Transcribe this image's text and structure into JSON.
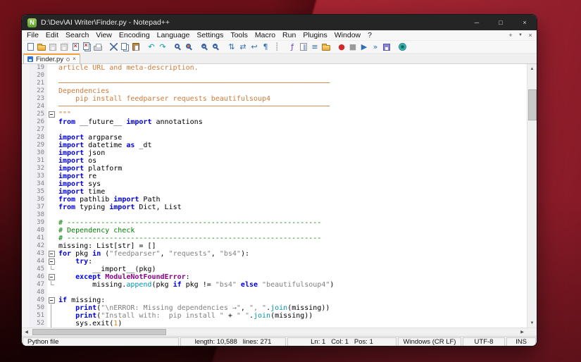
{
  "window": {
    "title": "D:\\Dev\\AI Writer\\Finder.py - Notepad++",
    "controls": {
      "minimize": "─",
      "maximize": "□",
      "close": "×"
    }
  },
  "menu": {
    "items": [
      "File",
      "Edit",
      "Search",
      "View",
      "Encoding",
      "Language",
      "Settings",
      "Tools",
      "Macro",
      "Run",
      "Plugins",
      "Window",
      "?"
    ],
    "extra": {
      "plus": "+",
      "dropdown": "▼",
      "close": "×"
    }
  },
  "toolbar": {
    "icons": [
      {
        "name": "new-file-icon",
        "shape": "doc"
      },
      {
        "name": "open-file-icon",
        "shape": "folder"
      },
      {
        "name": "save-icon",
        "shape": "save-gray"
      },
      {
        "name": "save-all-icon",
        "shape": "saveall-gray"
      },
      {
        "name": "close-file-icon",
        "shape": "close"
      },
      {
        "name": "close-all-icon",
        "shape": "close-all"
      },
      {
        "name": "print-icon",
        "shape": "print"
      },
      {
        "sep": true
      },
      {
        "name": "cut-icon",
        "shape": "cut"
      },
      {
        "name": "copy-icon",
        "shape": "copy"
      },
      {
        "name": "paste-icon",
        "shape": "paste"
      },
      {
        "sep": true
      },
      {
        "name": "undo-icon",
        "glyph": "↶",
        "color": "#0a9ba0"
      },
      {
        "name": "redo-icon",
        "glyph": "↷",
        "color": "#0a9ba0"
      },
      {
        "sep": true
      },
      {
        "name": "find-icon",
        "shape": "find"
      },
      {
        "name": "replace-icon",
        "shape": "replace"
      },
      {
        "sep": true
      },
      {
        "name": "zoom-in-icon",
        "shape": "zoom-in"
      },
      {
        "name": "zoom-out-icon",
        "shape": "zoom-out"
      },
      {
        "sep": true
      },
      {
        "name": "sync-vertical-scroll-icon",
        "glyph": "⇅",
        "color": "#2e6fb2"
      },
      {
        "name": "sync-horizontal-scroll-icon",
        "glyph": "⇄",
        "color": "#2e6fb2"
      },
      {
        "name": "word-wrap-icon",
        "glyph": "↩",
        "color": "#2e6fb2"
      },
      {
        "name": "show-all-characters-icon",
        "glyph": "¶",
        "color": "#2e6fb2"
      },
      {
        "name": "show-indent-guide-icon",
        "glyph": "┊",
        "color": "#7a7a7a"
      },
      {
        "sep": true
      },
      {
        "name": "function-list-icon",
        "glyph": "ƒ",
        "color": "#6a3fb5"
      },
      {
        "name": "document-map-icon",
        "shape": "map"
      },
      {
        "name": "document-list-icon",
        "glyph": "≡",
        "color": "#2e6fb2"
      },
      {
        "name": "folder-as-workspace-icon",
        "shape": "folder"
      },
      {
        "sep": true
      },
      {
        "name": "macro-record-icon",
        "glyph": "●",
        "color": "#d02a2a"
      },
      {
        "name": "macro-stop-icon",
        "glyph": "■",
        "color": "#9a9a9a"
      },
      {
        "name": "macro-play-icon",
        "glyph": "▶",
        "color": "#2e6fb2"
      },
      {
        "name": "macro-run-multiple-icon",
        "glyph": "»",
        "color": "#2e6fb2"
      },
      {
        "name": "macro-save-icon",
        "shape": "save"
      },
      {
        "sep": true
      },
      {
        "name": "monitoring-eye-icon",
        "shape": "eye"
      }
    ]
  },
  "tabs": [
    {
      "label": "Finder.py"
    }
  ],
  "editor": {
    "lines": [
      {
        "no": 19,
        "fold": "",
        "segs": [
          [
            "d",
            "article URL and meta-description."
          ]
        ]
      },
      {
        "no": 20,
        "fold": "",
        "segs": []
      },
      {
        "no": 21,
        "fold": "",
        "segs": [
          [
            "d",
            "────────────────────────────────────────────────────────────────"
          ]
        ]
      },
      {
        "no": 22,
        "fold": "",
        "segs": [
          [
            "d",
            "Dependencies"
          ]
        ]
      },
      {
        "no": 23,
        "fold": "",
        "segs": [
          [
            "d",
            "    pip install feedparser requests beautifulsoup4"
          ]
        ]
      },
      {
        "no": 24,
        "fold": "",
        "segs": [
          [
            "d",
            "────────────────────────────────────────────────────────────────"
          ]
        ]
      },
      {
        "no": 25,
        "fold": "box",
        "segs": [
          [
            "d",
            "\"\"\""
          ]
        ]
      },
      {
        "no": 26,
        "fold": "",
        "segs": [
          [
            "k",
            "from"
          ],
          [
            "p",
            " __future__ "
          ],
          [
            "k",
            "import"
          ],
          [
            "p",
            " annotations"
          ]
        ]
      },
      {
        "no": 27,
        "fold": "",
        "segs": []
      },
      {
        "no": 28,
        "fold": "",
        "segs": [
          [
            "k",
            "import"
          ],
          [
            "p",
            " argparse"
          ]
        ]
      },
      {
        "no": 29,
        "fold": "",
        "segs": [
          [
            "k",
            "import"
          ],
          [
            "p",
            " datetime "
          ],
          [
            "k",
            "as"
          ],
          [
            "p",
            " _dt"
          ]
        ]
      },
      {
        "no": 30,
        "fold": "",
        "segs": [
          [
            "k",
            "import"
          ],
          [
            "p",
            " json"
          ]
        ]
      },
      {
        "no": 31,
        "fold": "",
        "segs": [
          [
            "k",
            "import"
          ],
          [
            "p",
            " os"
          ]
        ]
      },
      {
        "no": 32,
        "fold": "",
        "segs": [
          [
            "k",
            "import"
          ],
          [
            "p",
            " platform"
          ]
        ]
      },
      {
        "no": 33,
        "fold": "",
        "segs": [
          [
            "k",
            "import"
          ],
          [
            "p",
            " re"
          ]
        ]
      },
      {
        "no": 34,
        "fold": "",
        "segs": [
          [
            "k",
            "import"
          ],
          [
            "p",
            " sys"
          ]
        ]
      },
      {
        "no": 35,
        "fold": "",
        "segs": [
          [
            "k",
            "import"
          ],
          [
            "p",
            " time"
          ]
        ]
      },
      {
        "no": 36,
        "fold": "",
        "segs": [
          [
            "k",
            "from"
          ],
          [
            "p",
            " pathlib "
          ],
          [
            "k",
            "import"
          ],
          [
            "p",
            " Path"
          ]
        ]
      },
      {
        "no": 37,
        "fold": "",
        "segs": [
          [
            "k",
            "from"
          ],
          [
            "p",
            " typing "
          ],
          [
            "k",
            "import"
          ],
          [
            "p",
            " Dict, List"
          ]
        ]
      },
      {
        "no": 38,
        "fold": "",
        "segs": []
      },
      {
        "no": 39,
        "fold": "",
        "segs": [
          [
            "c",
            "# ------------------------------------------------------------"
          ]
        ]
      },
      {
        "no": 40,
        "fold": "",
        "segs": [
          [
            "c",
            "# Dependency check"
          ]
        ]
      },
      {
        "no": 41,
        "fold": "",
        "segs": [
          [
            "c",
            "# ------------------------------------------------------------"
          ]
        ]
      },
      {
        "no": 42,
        "fold": "",
        "segs": [
          [
            "p",
            "missing: List[str] = []"
          ]
        ]
      },
      {
        "no": 43,
        "fold": "box",
        "segs": [
          [
            "k",
            "for"
          ],
          [
            "p",
            " pkg "
          ],
          [
            "k",
            "in"
          ],
          [
            "p",
            " ("
          ],
          [
            "s",
            "\"feedparser\""
          ],
          [
            "p",
            ", "
          ],
          [
            "s",
            "\"requests\""
          ],
          [
            "p",
            ", "
          ],
          [
            "s",
            "\"bs4\""
          ],
          [
            "p",
            "):"
          ]
        ]
      },
      {
        "no": 44,
        "fold": "box",
        "segs": [
          [
            "p",
            "    "
          ],
          [
            "k",
            "try"
          ],
          [
            "p",
            ":"
          ]
        ]
      },
      {
        "no": 45,
        "fold": "corner",
        "segs": [
          [
            "p",
            "        __import__(pkg)"
          ]
        ]
      },
      {
        "no": 46,
        "fold": "box",
        "segs": [
          [
            "p",
            "    "
          ],
          [
            "k",
            "except"
          ],
          [
            "p",
            " "
          ],
          [
            "t",
            "ModuleNotFoundError"
          ],
          [
            "p",
            ":"
          ]
        ]
      },
      {
        "no": 47,
        "fold": "corner",
        "segs": [
          [
            "p",
            "        missing."
          ],
          [
            "m",
            "append"
          ],
          [
            "p",
            "(pkg "
          ],
          [
            "k",
            "if"
          ],
          [
            "p",
            " pkg != "
          ],
          [
            "s",
            "\"bs4\""
          ],
          [
            "p",
            " "
          ],
          [
            "k",
            "else"
          ],
          [
            "p",
            " "
          ],
          [
            "s",
            "\"beautifulsoup4\""
          ],
          [
            "p",
            ")"
          ]
        ]
      },
      {
        "no": 48,
        "fold": "",
        "segs": []
      },
      {
        "no": 49,
        "fold": "box",
        "segs": [
          [
            "k",
            "if"
          ],
          [
            "p",
            " missing:"
          ]
        ]
      },
      {
        "no": 50,
        "fold": "line",
        "segs": [
          [
            "p",
            "    "
          ],
          [
            "k",
            "print"
          ],
          [
            "p",
            "("
          ],
          [
            "s",
            "\"\\nERROR: Missing dependencies →\""
          ],
          [
            "p",
            ", "
          ],
          [
            "s",
            "\", \""
          ],
          [
            "p",
            "."
          ],
          [
            "m",
            "join"
          ],
          [
            "p",
            "(missing))"
          ]
        ]
      },
      {
        "no": 51,
        "fold": "line",
        "segs": [
          [
            "p",
            "    "
          ],
          [
            "k",
            "print"
          ],
          [
            "p",
            "("
          ],
          [
            "s",
            "\"Install with:  pip install \""
          ],
          [
            "p",
            " + "
          ],
          [
            "s",
            "\" \""
          ],
          [
            "p",
            "."
          ],
          [
            "m",
            "join"
          ],
          [
            "p",
            "(missing))"
          ]
        ]
      },
      {
        "no": 52,
        "fold": "line",
        "segs": [
          [
            "p",
            "    sys.exit("
          ],
          [
            "n",
            "1"
          ],
          [
            "p",
            ")"
          ]
        ]
      }
    ]
  },
  "scrollbars": {
    "up": "▲",
    "down": "▼",
    "left": "◀",
    "right": "▶"
  },
  "statusbar": {
    "doc_type": "Python file",
    "length_info": "length: 10,588   lines: 271",
    "cursor_info": "Ln: 1   Col: 1   Pos: 1",
    "eol": "Windows (CR LF)",
    "encoding": "UTF-8",
    "insert_mode": "INS"
  }
}
